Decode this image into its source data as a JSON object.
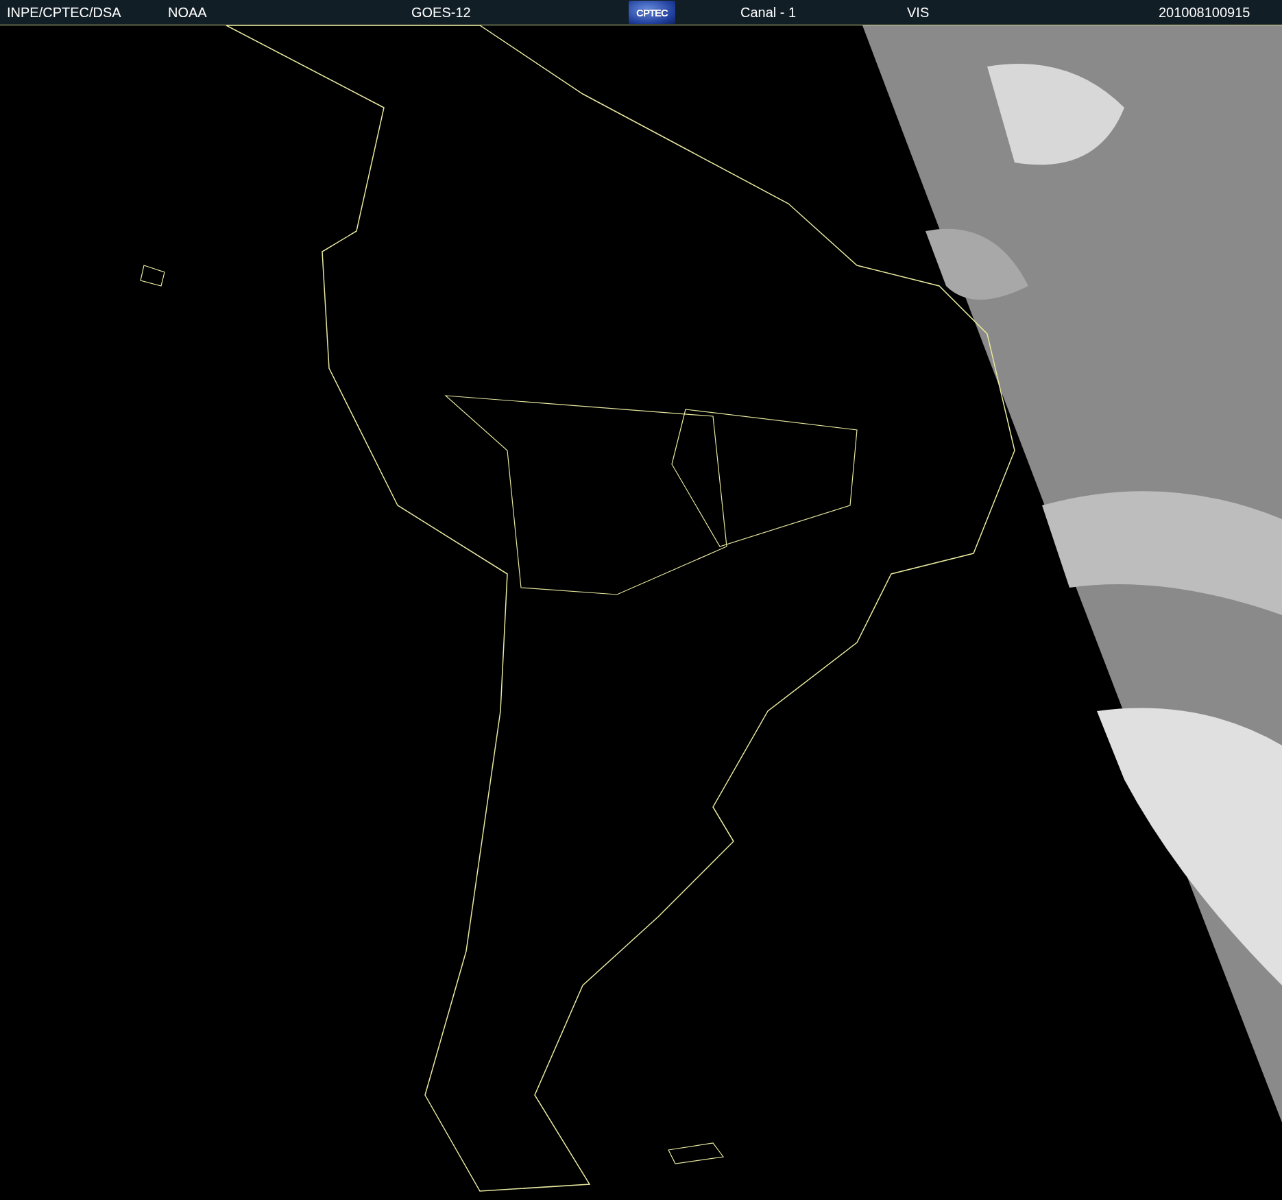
{
  "header": {
    "items": [
      {
        "kind": "text",
        "label": "INPE/CPTEC/DSA"
      },
      {
        "kind": "text",
        "label": "NOAA"
      },
      {
        "kind": "text",
        "label": "GOES-12"
      },
      {
        "kind": "logo",
        "label": "CPTEC"
      },
      {
        "kind": "text",
        "label": "Canal - 1"
      },
      {
        "kind": "text",
        "label": "VIS"
      },
      {
        "kind": "text",
        "label": "201008100915"
      }
    ]
  }
}
